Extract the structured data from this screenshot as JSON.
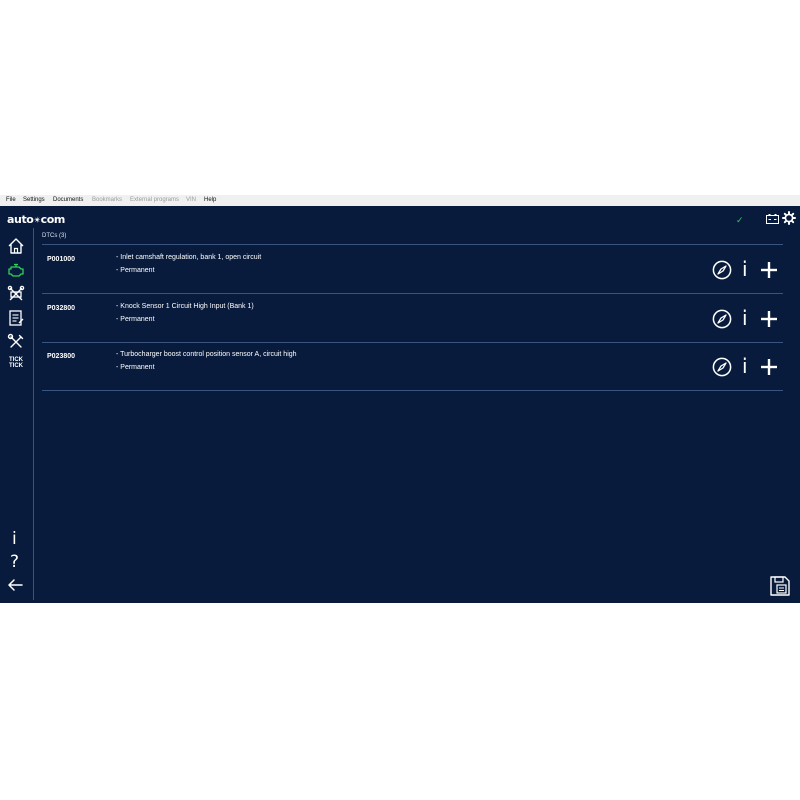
{
  "menu": [
    {
      "label": "File",
      "enabled": true
    },
    {
      "label": "Settings",
      "enabled": true
    },
    {
      "label": "Documents",
      "enabled": true
    },
    {
      "label": "Bookmarks",
      "enabled": false
    },
    {
      "label": "External programs",
      "enabled": false
    },
    {
      "label": "VIN",
      "enabled": false
    },
    {
      "label": "Help",
      "enabled": true
    }
  ],
  "app": {
    "logo_left": "auto",
    "logo_mid": "✴",
    "logo_right": "com",
    "status_check": "✓"
  },
  "sidebar": {
    "tick_line1": "TICK",
    "tick_line2": "TICK",
    "info_symbol": "i",
    "help_symbol": "?"
  },
  "dtc": {
    "header": "DTCs (3)",
    "rows": [
      {
        "code": "P001000",
        "description": "- Inlet camshaft regulation, bank 1, open circuit",
        "status": "- Permanent"
      },
      {
        "code": "P032800",
        "description": "- Knock Sensor 1 Circuit High Input (Bank 1)",
        "status": "- Permanent"
      },
      {
        "code": "P023800",
        "description": "- Turbocharger boost control position sensor A, circuit high",
        "status": "- Permanent"
      }
    ],
    "info_symbol": "i"
  },
  "colors": {
    "background": "#081b3d",
    "separator": "#3a5480",
    "accent_green": "#30d158",
    "menu_bar": "#f0f0f0"
  },
  "icons": [
    "home-icon",
    "engine-icon",
    "crossed-tools-icon",
    "document-icon",
    "wrench-screwdriver-icon",
    "battery-icon",
    "gear-icon",
    "compass-icon",
    "plus-icon",
    "save-report-icon",
    "back-arrow-icon"
  ]
}
